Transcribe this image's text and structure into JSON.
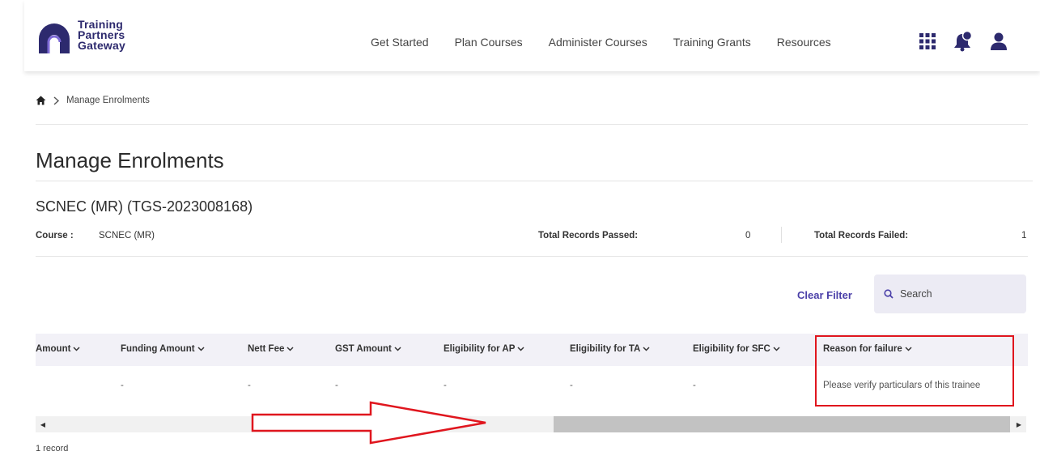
{
  "header": {
    "logo_lines": [
      "Training",
      "Partners",
      "Gateway"
    ],
    "nav": [
      "Get Started",
      "Plan Courses",
      "Administer Courses",
      "Training Grants",
      "Resources"
    ],
    "icons": [
      "apps-grid-icon",
      "notification-bell-icon",
      "user-profile-icon"
    ]
  },
  "breadcrumb": {
    "home_icon": "home-icon",
    "separator_icon": "chevron-right-icon",
    "current": "Manage Enrolments"
  },
  "page": {
    "title": "Manage Enrolments",
    "subtitle": "SCNEC (MR) (TGS-2023008168)"
  },
  "info": {
    "course_label": "Course :",
    "course_value": "SCNEC (MR)",
    "passed_label": "Total Records Passed:",
    "passed_value": "0",
    "failed_label": "Total Records Failed:",
    "failed_value": "1"
  },
  "toolbar": {
    "clear_filter": "Clear Filter",
    "search_placeholder": "Search"
  },
  "table": {
    "columns": [
      "Amount",
      "Funding Amount",
      "Nett Fee",
      "GST Amount",
      "Eligibility for AP",
      "Eligibility for TA",
      "Eligibility for SFC",
      "Reason for failure"
    ],
    "rows": [
      [
        "",
        "-",
        "-",
        "-",
        "-",
        "-",
        "-",
        "Please verify particulars of this trainee"
      ]
    ]
  },
  "footer": {
    "record_count": "1 record"
  },
  "colors": {
    "accent": "#4a3fa8",
    "highlight": "#e0161e",
    "header_bg": "#f2f1f7"
  }
}
